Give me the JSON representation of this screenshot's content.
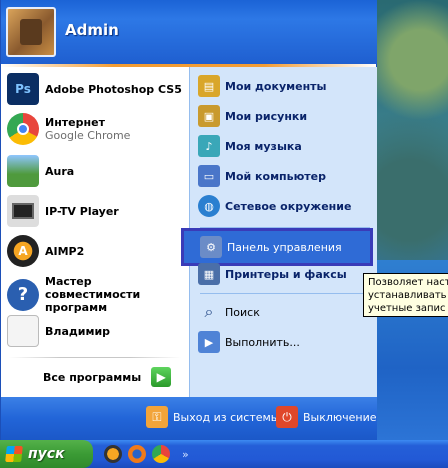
{
  "user": {
    "name": "Admin"
  },
  "left_items": [
    {
      "label": "Adobe Photoshop CS5",
      "icon": "photoshop-icon",
      "glyph": "Ps",
      "color": "#0a3a7a"
    },
    {
      "label": "Интернет",
      "sub": "Google Chrome",
      "icon": "chrome-icon",
      "glyph": "",
      "color": "#e8453c"
    },
    {
      "label": "Aura",
      "icon": "aura-icon",
      "glyph": "",
      "color": "#4f9a3d"
    },
    {
      "label": "IP-TV Player",
      "icon": "iptv-icon",
      "glyph": "",
      "color": "#333333"
    },
    {
      "label": "AIMP2",
      "icon": "aimp-icon",
      "glyph": "A",
      "color": "#f08a13"
    },
    {
      "label": "Мастер совместимости программ",
      "icon": "help-icon",
      "glyph": "?",
      "color": "#2a5fb0"
    },
    {
      "label": "Владимир",
      "icon": "document-icon",
      "glyph": "",
      "color": "#e9e9e9"
    }
  ],
  "all_programs": "Все программы",
  "right_items": [
    {
      "label": "Мои документы",
      "icon": "my-documents-icon",
      "color": "#d9a62a"
    },
    {
      "label": "Мои рисунки",
      "icon": "my-pictures-icon",
      "color": "#c99a2e"
    },
    {
      "label": "Моя музыка",
      "icon": "my-music-icon",
      "color": "#3aa7b8"
    },
    {
      "label": "Мой компьютер",
      "icon": "my-computer-icon",
      "color": "#4a76c9"
    },
    {
      "label": "Сетевое окружение",
      "icon": "network-icon",
      "color": "#2a7fd0"
    },
    {
      "label": "Панель управления",
      "icon": "control-panel-icon",
      "color": "#6b8cc7"
    },
    {
      "label": "Принтеры и факсы",
      "icon": "printer-icon",
      "color": "#4b6fa8"
    },
    {
      "label": "Поиск",
      "icon": "search-icon",
      "color": "#6a8fb8"
    },
    {
      "label": "Выполнить...",
      "icon": "run-icon",
      "color": "#4f83d6"
    }
  ],
  "footer": {
    "logoff": "Выход из системы",
    "shutdown": "Выключение"
  },
  "tooltip": [
    "Позволяет наст",
    "устанавливать",
    "учетные запис"
  ],
  "taskbar": {
    "start": "пуск",
    "more": "»"
  }
}
